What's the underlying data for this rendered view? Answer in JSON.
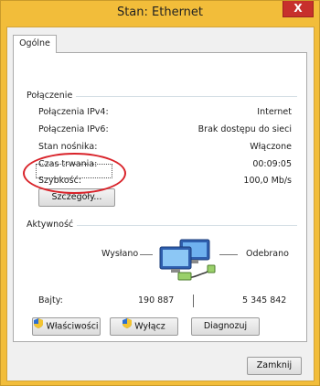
{
  "window": {
    "title": "Stan: Ethernet",
    "close_glyph": "X"
  },
  "tabs": [
    {
      "label": "Ogólne",
      "active": true
    }
  ],
  "connection": {
    "heading": "Połączenie",
    "rows": [
      {
        "label": "Połączenia IPv4:",
        "value": "Internet"
      },
      {
        "label": "Połączenia IPv6:",
        "value": "Brak dostępu do sieci"
      },
      {
        "label": "Stan nośnika:",
        "value": "Włączone"
      },
      {
        "label": "Czas trwania:",
        "value": "00:09:05"
      },
      {
        "label": "Szybkość:",
        "value": "100,0 Mb/s"
      }
    ],
    "details_button": "Szczegóły..."
  },
  "activity": {
    "heading": "Aktywność",
    "sent_label": "Wysłano",
    "received_label": "Odebrano",
    "bytes_label": "Bajty:",
    "bytes_sent": "190 887",
    "bytes_received": "5 345 842",
    "icon": "network-computers-icon"
  },
  "buttons": {
    "properties": "Właściwości",
    "disable": "Wyłącz",
    "diagnose": "Diagnozuj",
    "close": "Zamknij"
  },
  "colors": {
    "frame": "#f2bd3a",
    "close_button": "#c7302c",
    "annotation": "#d9232a"
  }
}
